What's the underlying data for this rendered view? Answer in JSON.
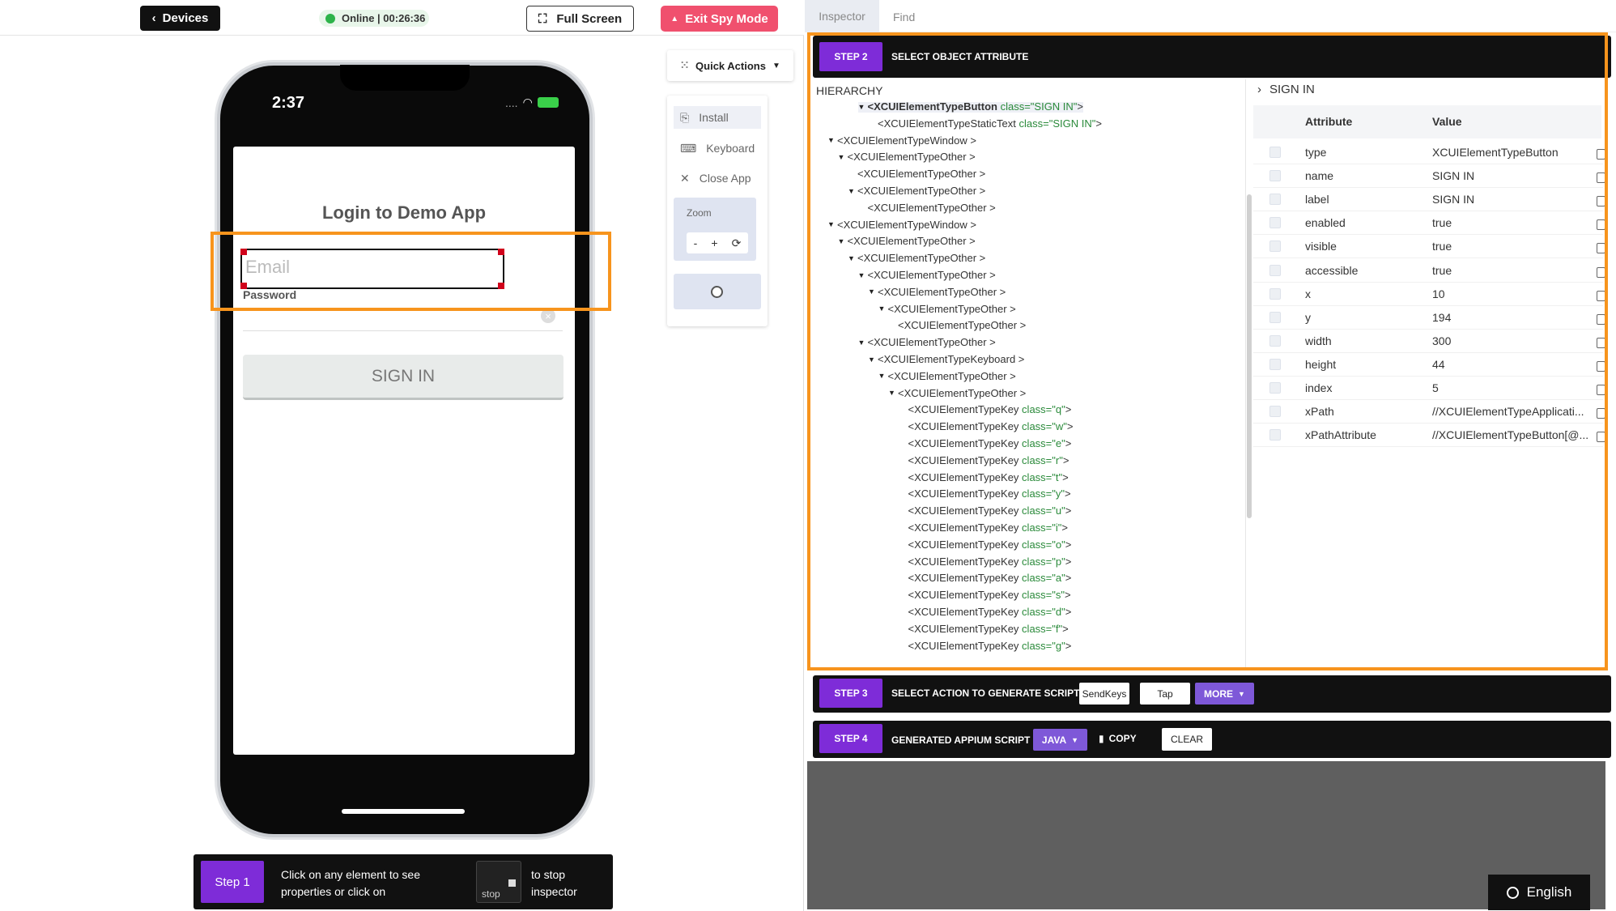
{
  "topbar": {
    "devices_label": "Devices",
    "online_label": "Online | 00:26:36",
    "fullscreen_label": "Full Screen",
    "exit_label": "Exit Spy Mode"
  },
  "phone": {
    "time": "2:37",
    "signal": "....",
    "title": "Login to Demo App",
    "email_placeholder": "Email",
    "password_label": "Password",
    "signin_label": "SIGN IN"
  },
  "quick_actions": {
    "label": "Quick Actions",
    "items": [
      {
        "label": "Install",
        "icon": "install-icon"
      },
      {
        "label": "Keyboard",
        "icon": "keyboard-icon"
      },
      {
        "label": "Close App",
        "icon": "close-icon"
      }
    ],
    "zoom_label": "Zoom",
    "zoom_minus": "-",
    "zoom_plus": "+"
  },
  "step1": {
    "badge": "Step 1",
    "text": "Click on any element to see properties or click on",
    "stop_label": "stop",
    "text2": "to stop inspector"
  },
  "right_tabs": {
    "inspector": "Inspector",
    "find": "Find"
  },
  "step2": {
    "badge": "STEP 2",
    "label": "SELECT OBJECT ATTRIBUTE"
  },
  "hierarchy": {
    "heading": "HIERARCHY",
    "nodes": [
      {
        "indent": 3,
        "toggle": "▼",
        "tag": "<XCUIElementTypeButton",
        "cls": " class=\"SIGN IN\"",
        "end": ">",
        "selected": true
      },
      {
        "indent": 4,
        "toggle": "",
        "tag": "<XCUIElementTypeStaticText",
        "cls": " class=\"SIGN IN\"",
        "end": ">"
      },
      {
        "indent": 0,
        "toggle": "▼",
        "tag": "<XCUIElementTypeWindow",
        "cls": "",
        "end": " >"
      },
      {
        "indent": 1,
        "toggle": "▼",
        "tag": "<XCUIElementTypeOther",
        "cls": "",
        "end": " >"
      },
      {
        "indent": 2,
        "toggle": "",
        "tag": "<XCUIElementTypeOther",
        "cls": "",
        "end": " >"
      },
      {
        "indent": 2,
        "toggle": "▼",
        "tag": "<XCUIElementTypeOther",
        "cls": "",
        "end": " >"
      },
      {
        "indent": 3,
        "toggle": "",
        "tag": "<XCUIElementTypeOther",
        "cls": "",
        "end": " >"
      },
      {
        "indent": 0,
        "toggle": "▼",
        "tag": "<XCUIElementTypeWindow",
        "cls": "",
        "end": " >"
      },
      {
        "indent": 1,
        "toggle": "▼",
        "tag": "<XCUIElementTypeOther",
        "cls": "",
        "end": " >"
      },
      {
        "indent": 2,
        "toggle": "▼",
        "tag": "<XCUIElementTypeOther",
        "cls": "",
        "end": " >"
      },
      {
        "indent": 3,
        "toggle": "▼",
        "tag": "<XCUIElementTypeOther",
        "cls": "",
        "end": " >"
      },
      {
        "indent": 4,
        "toggle": "▼",
        "tag": "<XCUIElementTypeOther",
        "cls": "",
        "end": " >"
      },
      {
        "indent": 5,
        "toggle": "▼",
        "tag": "<XCUIElementTypeOther",
        "cls": "",
        "end": " >"
      },
      {
        "indent": 6,
        "toggle": "",
        "tag": "<XCUIElementTypeOther",
        "cls": "",
        "end": " >"
      },
      {
        "indent": 3,
        "toggle": "▼",
        "tag": "<XCUIElementTypeOther",
        "cls": "",
        "end": " >"
      },
      {
        "indent": 4,
        "toggle": "▼",
        "tag": "<XCUIElementTypeKeyboard",
        "cls": "",
        "end": " >"
      },
      {
        "indent": 5,
        "toggle": "▼",
        "tag": "<XCUIElementTypeOther",
        "cls": "",
        "end": " >"
      },
      {
        "indent": 6,
        "toggle": "▼",
        "tag": "<XCUIElementTypeOther",
        "cls": "",
        "end": " >"
      },
      {
        "indent": 7,
        "toggle": "",
        "tag": "<XCUIElementTypeKey",
        "cls": " class=\"q\"",
        "end": ">"
      },
      {
        "indent": 7,
        "toggle": "",
        "tag": "<XCUIElementTypeKey",
        "cls": " class=\"w\"",
        "end": ">"
      },
      {
        "indent": 7,
        "toggle": "",
        "tag": "<XCUIElementTypeKey",
        "cls": " class=\"e\"",
        "end": ">"
      },
      {
        "indent": 7,
        "toggle": "",
        "tag": "<XCUIElementTypeKey",
        "cls": " class=\"r\"",
        "end": ">"
      },
      {
        "indent": 7,
        "toggle": "",
        "tag": "<XCUIElementTypeKey",
        "cls": " class=\"t\"",
        "end": ">"
      },
      {
        "indent": 7,
        "toggle": "",
        "tag": "<XCUIElementTypeKey",
        "cls": " class=\"y\"",
        "end": ">"
      },
      {
        "indent": 7,
        "toggle": "",
        "tag": "<XCUIElementTypeKey",
        "cls": " class=\"u\"",
        "end": ">"
      },
      {
        "indent": 7,
        "toggle": "",
        "tag": "<XCUIElementTypeKey",
        "cls": " class=\"i\"",
        "end": ">"
      },
      {
        "indent": 7,
        "toggle": "",
        "tag": "<XCUIElementTypeKey",
        "cls": " class=\"o\"",
        "end": ">"
      },
      {
        "indent": 7,
        "toggle": "",
        "tag": "<XCUIElementTypeKey",
        "cls": " class=\"p\"",
        "end": ">"
      },
      {
        "indent": 7,
        "toggle": "",
        "tag": "<XCUIElementTypeKey",
        "cls": " class=\"a\"",
        "end": ">"
      },
      {
        "indent": 7,
        "toggle": "",
        "tag": "<XCUIElementTypeKey",
        "cls": " class=\"s\"",
        "end": ">"
      },
      {
        "indent": 7,
        "toggle": "",
        "tag": "<XCUIElementTypeKey",
        "cls": " class=\"d\"",
        "end": ">"
      },
      {
        "indent": 7,
        "toggle": "",
        "tag": "<XCUIElementTypeKey",
        "cls": " class=\"f\"",
        "end": ">"
      },
      {
        "indent": 7,
        "toggle": "",
        "tag": "<XCUIElementTypeKey",
        "cls": " class=\"g\"",
        "end": ">"
      }
    ]
  },
  "attributes": {
    "heading": "SIGN IN",
    "col_attr": "Attribute",
    "col_value": "Value",
    "rows": [
      {
        "name": "type",
        "value": "XCUIElementTypeButton"
      },
      {
        "name": "name",
        "value": "SIGN IN"
      },
      {
        "name": "label",
        "value": "SIGN IN"
      },
      {
        "name": "enabled",
        "value": "true"
      },
      {
        "name": "visible",
        "value": "true"
      },
      {
        "name": "accessible",
        "value": "true"
      },
      {
        "name": "x",
        "value": "10"
      },
      {
        "name": "y",
        "value": "194"
      },
      {
        "name": "width",
        "value": "300"
      },
      {
        "name": "height",
        "value": "44"
      },
      {
        "name": "index",
        "value": "5"
      },
      {
        "name": "xPath",
        "value": "//XCUIElementTypeApplicati..."
      },
      {
        "name": "xPathAttribute",
        "value": "//XCUIElementTypeButton[@..."
      }
    ]
  },
  "step3": {
    "badge": "STEP 3",
    "label": "SELECT ACTION TO GENERATE SCRIPT",
    "sendkeys": "SendKeys",
    "tap": "Tap",
    "more": "MORE"
  },
  "step4": {
    "badge": "STEP 4",
    "label": "GENERATED APPIUM SCRIPT",
    "lang": "JAVA",
    "copy": "COPY",
    "clear": "CLEAR"
  },
  "language": "English",
  "colors": {
    "accent": "#7e2cd8",
    "highlight": "#f7941d",
    "exit": "#f0506e",
    "online": "#2db34a"
  }
}
